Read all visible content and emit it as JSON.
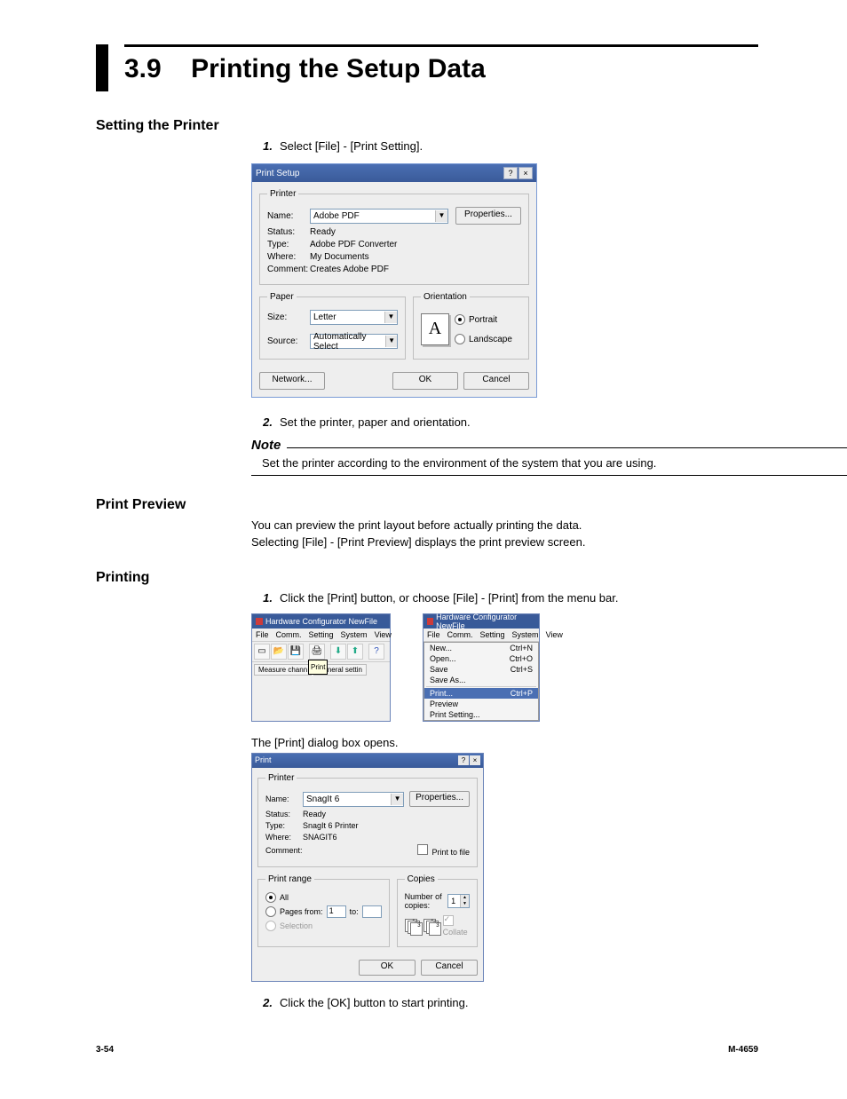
{
  "section": {
    "number": "3.9",
    "title": "Printing the Setup Data"
  },
  "sub1": {
    "title": "Setting the Printer",
    "step1_num": "1.",
    "step1": "Select [File] - [Print Setting].",
    "step2_num": "2.",
    "step2": "Set the printer, paper and orientation.",
    "note_title": "Note",
    "note_body": "Set the printer according to the environment of the system that you are using."
  },
  "print_setup": {
    "title": "Print Setup",
    "help": "?",
    "close": "×",
    "printer_legend": "Printer",
    "name_lbl": "Name:",
    "name_val": "Adobe PDF",
    "props_btn": "Properties...",
    "status_lbl": "Status:",
    "status_val": "Ready",
    "type_lbl": "Type:",
    "type_val": "Adobe PDF Converter",
    "where_lbl": "Where:",
    "where_val": "My Documents",
    "comment_lbl": "Comment:",
    "comment_val": "Creates Adobe PDF",
    "paper_legend": "Paper",
    "size_lbl": "Size:",
    "size_val": "Letter",
    "source_lbl": "Source:",
    "source_val": "Automatically Select",
    "orient_legend": "Orientation",
    "orient_preview": "A",
    "portrait": "Portrait",
    "landscape": "Landscape",
    "network_btn": "Network...",
    "ok_btn": "OK",
    "cancel_btn": "Cancel"
  },
  "sub2": {
    "title": "Print Preview",
    "p1": "You can preview the print layout before actually printing the data.",
    "p2": "Selecting [File] - [Print Preview] displays the print preview screen."
  },
  "sub3": {
    "title": "Printing",
    "step1_num": "1.",
    "step1": "Click the [Print] button, or choose [File] - [Print] from the menu bar.",
    "caption": "The [Print] dialog box opens.",
    "step2_num": "2.",
    "step2": "Click the [OK] button to start printing."
  },
  "app1": {
    "title": "Hardware Configurator NewFile",
    "menu": [
      "File",
      "Comm.",
      "Setting",
      "System",
      "View"
    ],
    "tooltip": "Print",
    "tab1": "Measure chann",
    "tab2": "General settin"
  },
  "app2": {
    "title": "Hardware Configurator NewFile",
    "menu": [
      "File",
      "Comm.",
      "Setting",
      "System",
      "View"
    ],
    "items": [
      {
        "l": "New...",
        "r": "Ctrl+N"
      },
      {
        "l": "Open...",
        "r": "Ctrl+O"
      },
      {
        "l": "Save",
        "r": "Ctrl+S"
      },
      {
        "l": "Save As...",
        "r": ""
      }
    ],
    "sel": {
      "l": "Print...",
      "r": "Ctrl+P"
    },
    "items2": [
      {
        "l": "Preview",
        "r": ""
      },
      {
        "l": "Print Setting...",
        "r": ""
      }
    ]
  },
  "print_dlg": {
    "title": "Print",
    "help": "?",
    "close": "×",
    "printer_legend": "Printer",
    "name_lbl": "Name:",
    "name_val": "SnagIt 6",
    "props_btn": "Properties...",
    "status_lbl": "Status:",
    "status_val": "Ready",
    "type_lbl": "Type:",
    "type_val": "SnagIt 6 Printer",
    "where_lbl": "Where:",
    "where_val": "SNAGIT6",
    "comment_lbl": "Comment:",
    "print_to_file": "Print to file",
    "range_legend": "Print range",
    "all": "All",
    "pages": "Pages",
    "from": "from:",
    "from_val": "1",
    "to": "to:",
    "to_val": "",
    "selection": "Selection",
    "copies_legend": "Copies",
    "num_copies_lbl": "Number of copies:",
    "num_copies_val": "1",
    "collate": "Collate",
    "ok_btn": "OK",
    "cancel_btn": "Cancel"
  },
  "footer": {
    "left": "3-54",
    "right": "M-4659"
  }
}
